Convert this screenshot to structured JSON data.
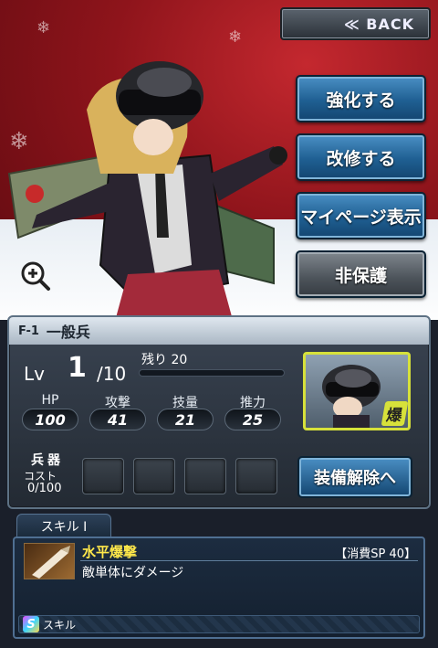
{
  "header": {
    "back_label": "≪ BACK"
  },
  "menu": {
    "enhance": "強化する",
    "modify": "改修する",
    "mypage": "マイページ表示",
    "unprotect": "非保護"
  },
  "unit": {
    "code": "F-1",
    "name": "一般兵",
    "lv_label": "Lv",
    "level": "1",
    "level_max": "/10",
    "remaining": "残り 20",
    "exp_fraction": 0,
    "portrait_badge": "爆"
  },
  "stats": [
    {
      "label": "HP",
      "value": "100"
    },
    {
      "label": "攻撃",
      "value": "41"
    },
    {
      "label": "技量",
      "value": "21"
    },
    {
      "label": "推力",
      "value": "25"
    }
  ],
  "weapons": {
    "label": "兵器",
    "cost_label": "コスト",
    "cost_value": "0/100",
    "unequip_label": "装備解除へ"
  },
  "skill": {
    "tab_label": "スキル I",
    "name": "水平爆撃",
    "sp_cost": "【消費SP 40】",
    "description": "敵単体にダメージ",
    "footer_badge": "S",
    "footer_label": "スキル"
  },
  "colors": {
    "accent_blue": "#1f5f92",
    "skill_name": "#ffe84a",
    "background_red": "#8e141b"
  },
  "icons": {
    "zoom": "zoom-in-icon",
    "skill": "bomb-skill-icon"
  }
}
